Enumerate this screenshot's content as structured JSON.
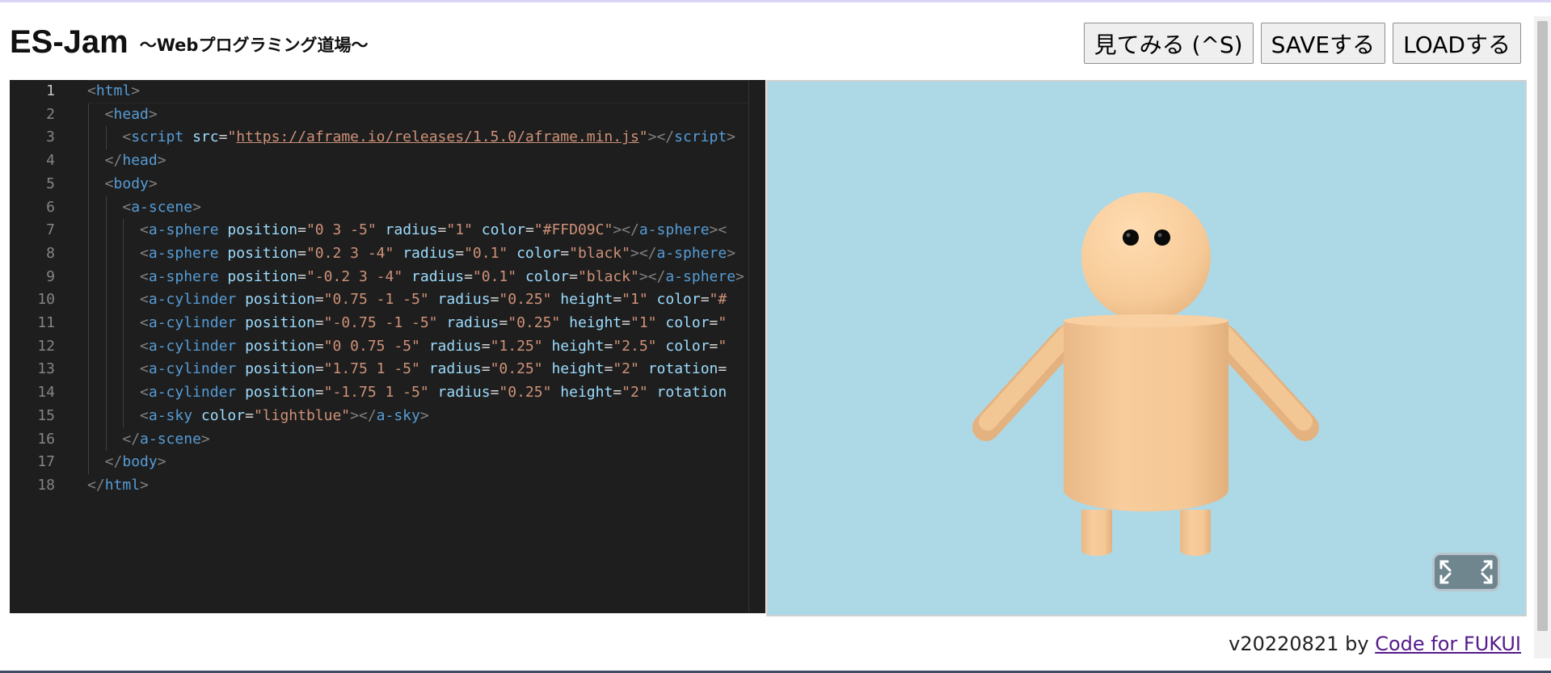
{
  "header": {
    "title": "ES-Jam",
    "subtitle": "～Webプログラミング道場～"
  },
  "toolbar": {
    "preview_label": "見てみる (^S)",
    "save_label": "SAVEする",
    "load_label": "LOADする"
  },
  "editor": {
    "active_line": 1,
    "lines": [
      [
        [
          "br",
          "<"
        ],
        [
          "tag",
          "html"
        ],
        [
          "br",
          ">"
        ]
      ],
      [
        [
          "br",
          "<"
        ],
        [
          "tag",
          "head"
        ],
        [
          "br",
          ">"
        ]
      ],
      [
        [
          "br",
          "<"
        ],
        [
          "tag",
          "script"
        ],
        [
          "sp",
          " "
        ],
        [
          "attr",
          "src"
        ],
        [
          "eq",
          "="
        ],
        [
          "str",
          "\""
        ],
        [
          "url",
          "https://aframe.io/releases/1.5.0/aframe.min.js"
        ],
        [
          "str",
          "\""
        ],
        [
          "br",
          "></"
        ],
        [
          "tag",
          "script"
        ],
        [
          "br",
          ">"
        ]
      ],
      [
        [
          "br",
          "</"
        ],
        [
          "tag",
          "head"
        ],
        [
          "br",
          ">"
        ]
      ],
      [
        [
          "br",
          "<"
        ],
        [
          "tag",
          "body"
        ],
        [
          "br",
          ">"
        ]
      ],
      [
        [
          "br",
          "<"
        ],
        [
          "tag",
          "a-scene"
        ],
        [
          "br",
          ">"
        ]
      ],
      [
        [
          "br",
          "<"
        ],
        [
          "tag",
          "a-sphere"
        ],
        [
          "sp",
          " "
        ],
        [
          "attr",
          "position"
        ],
        [
          "eq",
          "="
        ],
        [
          "str",
          "\"0 3 -5\""
        ],
        [
          "sp",
          " "
        ],
        [
          "attr",
          "radius"
        ],
        [
          "eq",
          "="
        ],
        [
          "str",
          "\"1\""
        ],
        [
          "sp",
          " "
        ],
        [
          "attr",
          "color"
        ],
        [
          "eq",
          "="
        ],
        [
          "str",
          "\"#FFD09C\""
        ],
        [
          "br",
          "></"
        ],
        [
          "tag",
          "a-sphere"
        ],
        [
          "br",
          "><"
        ]
      ],
      [
        [
          "br",
          "<"
        ],
        [
          "tag",
          "a-sphere"
        ],
        [
          "sp",
          " "
        ],
        [
          "attr",
          "position"
        ],
        [
          "eq",
          "="
        ],
        [
          "str",
          "\"0.2 3 -4\""
        ],
        [
          "sp",
          " "
        ],
        [
          "attr",
          "radius"
        ],
        [
          "eq",
          "="
        ],
        [
          "str",
          "\"0.1\""
        ],
        [
          "sp",
          " "
        ],
        [
          "attr",
          "color"
        ],
        [
          "eq",
          "="
        ],
        [
          "str",
          "\"black\""
        ],
        [
          "br",
          "></"
        ],
        [
          "tag",
          "a-sphere"
        ],
        [
          "br",
          ">"
        ]
      ],
      [
        [
          "br",
          "<"
        ],
        [
          "tag",
          "a-sphere"
        ],
        [
          "sp",
          " "
        ],
        [
          "attr",
          "position"
        ],
        [
          "eq",
          "="
        ],
        [
          "str",
          "\"-0.2 3 -4\""
        ],
        [
          "sp",
          " "
        ],
        [
          "attr",
          "radius"
        ],
        [
          "eq",
          "="
        ],
        [
          "str",
          "\"0.1\""
        ],
        [
          "sp",
          " "
        ],
        [
          "attr",
          "color"
        ],
        [
          "eq",
          "="
        ],
        [
          "str",
          "\"black\""
        ],
        [
          "br",
          "></"
        ],
        [
          "tag",
          "a-sphere"
        ],
        [
          "br",
          ">"
        ]
      ],
      [
        [
          "br",
          "<"
        ],
        [
          "tag",
          "a-cylinder"
        ],
        [
          "sp",
          " "
        ],
        [
          "attr",
          "position"
        ],
        [
          "eq",
          "="
        ],
        [
          "str",
          "\"0.75 -1 -5\""
        ],
        [
          "sp",
          " "
        ],
        [
          "attr",
          "radius"
        ],
        [
          "eq",
          "="
        ],
        [
          "str",
          "\"0.25\""
        ],
        [
          "sp",
          " "
        ],
        [
          "attr",
          "height"
        ],
        [
          "eq",
          "="
        ],
        [
          "str",
          "\"1\""
        ],
        [
          "sp",
          " "
        ],
        [
          "attr",
          "color"
        ],
        [
          "eq",
          "="
        ],
        [
          "str",
          "\"#"
        ]
      ],
      [
        [
          "br",
          "<"
        ],
        [
          "tag",
          "a-cylinder"
        ],
        [
          "sp",
          " "
        ],
        [
          "attr",
          "position"
        ],
        [
          "eq",
          "="
        ],
        [
          "str",
          "\"-0.75 -1 -5\""
        ],
        [
          "sp",
          " "
        ],
        [
          "attr",
          "radius"
        ],
        [
          "eq",
          "="
        ],
        [
          "str",
          "\"0.25\""
        ],
        [
          "sp",
          " "
        ],
        [
          "attr",
          "height"
        ],
        [
          "eq",
          "="
        ],
        [
          "str",
          "\"1\""
        ],
        [
          "sp",
          " "
        ],
        [
          "attr",
          "color"
        ],
        [
          "eq",
          "="
        ],
        [
          "str",
          "\""
        ]
      ],
      [
        [
          "br",
          "<"
        ],
        [
          "tag",
          "a-cylinder"
        ],
        [
          "sp",
          " "
        ],
        [
          "attr",
          "position"
        ],
        [
          "eq",
          "="
        ],
        [
          "str",
          "\"0 0.75 -5\""
        ],
        [
          "sp",
          " "
        ],
        [
          "attr",
          "radius"
        ],
        [
          "eq",
          "="
        ],
        [
          "str",
          "\"1.25\""
        ],
        [
          "sp",
          " "
        ],
        [
          "attr",
          "height"
        ],
        [
          "eq",
          "="
        ],
        [
          "str",
          "\"2.5\""
        ],
        [
          "sp",
          " "
        ],
        [
          "attr",
          "color"
        ],
        [
          "eq",
          "="
        ],
        [
          "str",
          "\""
        ]
      ],
      [
        [
          "br",
          "<"
        ],
        [
          "tag",
          "a-cylinder"
        ],
        [
          "sp",
          " "
        ],
        [
          "attr",
          "position"
        ],
        [
          "eq",
          "="
        ],
        [
          "str",
          "\"1.75 1 -5\""
        ],
        [
          "sp",
          " "
        ],
        [
          "attr",
          "radius"
        ],
        [
          "eq",
          "="
        ],
        [
          "str",
          "\"0.25\""
        ],
        [
          "sp",
          " "
        ],
        [
          "attr",
          "height"
        ],
        [
          "eq",
          "="
        ],
        [
          "str",
          "\"2\""
        ],
        [
          "sp",
          " "
        ],
        [
          "attr",
          "rotation"
        ],
        [
          "eq",
          "="
        ]
      ],
      [
        [
          "br",
          "<"
        ],
        [
          "tag",
          "a-cylinder"
        ],
        [
          "sp",
          " "
        ],
        [
          "attr",
          "position"
        ],
        [
          "eq",
          "="
        ],
        [
          "str",
          "\"-1.75 1 -5\""
        ],
        [
          "sp",
          " "
        ],
        [
          "attr",
          "radius"
        ],
        [
          "eq",
          "="
        ],
        [
          "str",
          "\"0.25\""
        ],
        [
          "sp",
          " "
        ],
        [
          "attr",
          "height"
        ],
        [
          "eq",
          "="
        ],
        [
          "str",
          "\"2\""
        ],
        [
          "sp",
          " "
        ],
        [
          "attr",
          "rotation"
        ]
      ],
      [
        [
          "br",
          "<"
        ],
        [
          "tag",
          "a-sky"
        ],
        [
          "sp",
          " "
        ],
        [
          "attr",
          "color"
        ],
        [
          "eq",
          "="
        ],
        [
          "str",
          "\"lightblue\""
        ],
        [
          "br",
          "></"
        ],
        [
          "tag",
          "a-sky"
        ],
        [
          "br",
          ">"
        ]
      ],
      [
        [
          "br",
          "</"
        ],
        [
          "tag",
          "a-scene"
        ],
        [
          "br",
          ">"
        ]
      ],
      [
        [
          "br",
          "</"
        ],
        [
          "tag",
          "body"
        ],
        [
          "br",
          ">"
        ]
      ],
      [
        [
          "br",
          "</"
        ],
        [
          "tag",
          "html"
        ],
        [
          "br",
          ">"
        ]
      ]
    ]
  },
  "preview": {
    "sky_color": "#add8e6",
    "skin_color": "#FFD09C",
    "eye_color": "black",
    "fullscreen_icon": "fullscreen-icon"
  },
  "footer": {
    "version": "v20220821 by ",
    "link_label": "Code for FUKUI"
  },
  "colors": {
    "editor_bg": "#1e1e1e",
    "tag": "#569cd6",
    "attribute": "#9cdcfe",
    "string": "#ce9178",
    "punctuation": "#808080"
  }
}
